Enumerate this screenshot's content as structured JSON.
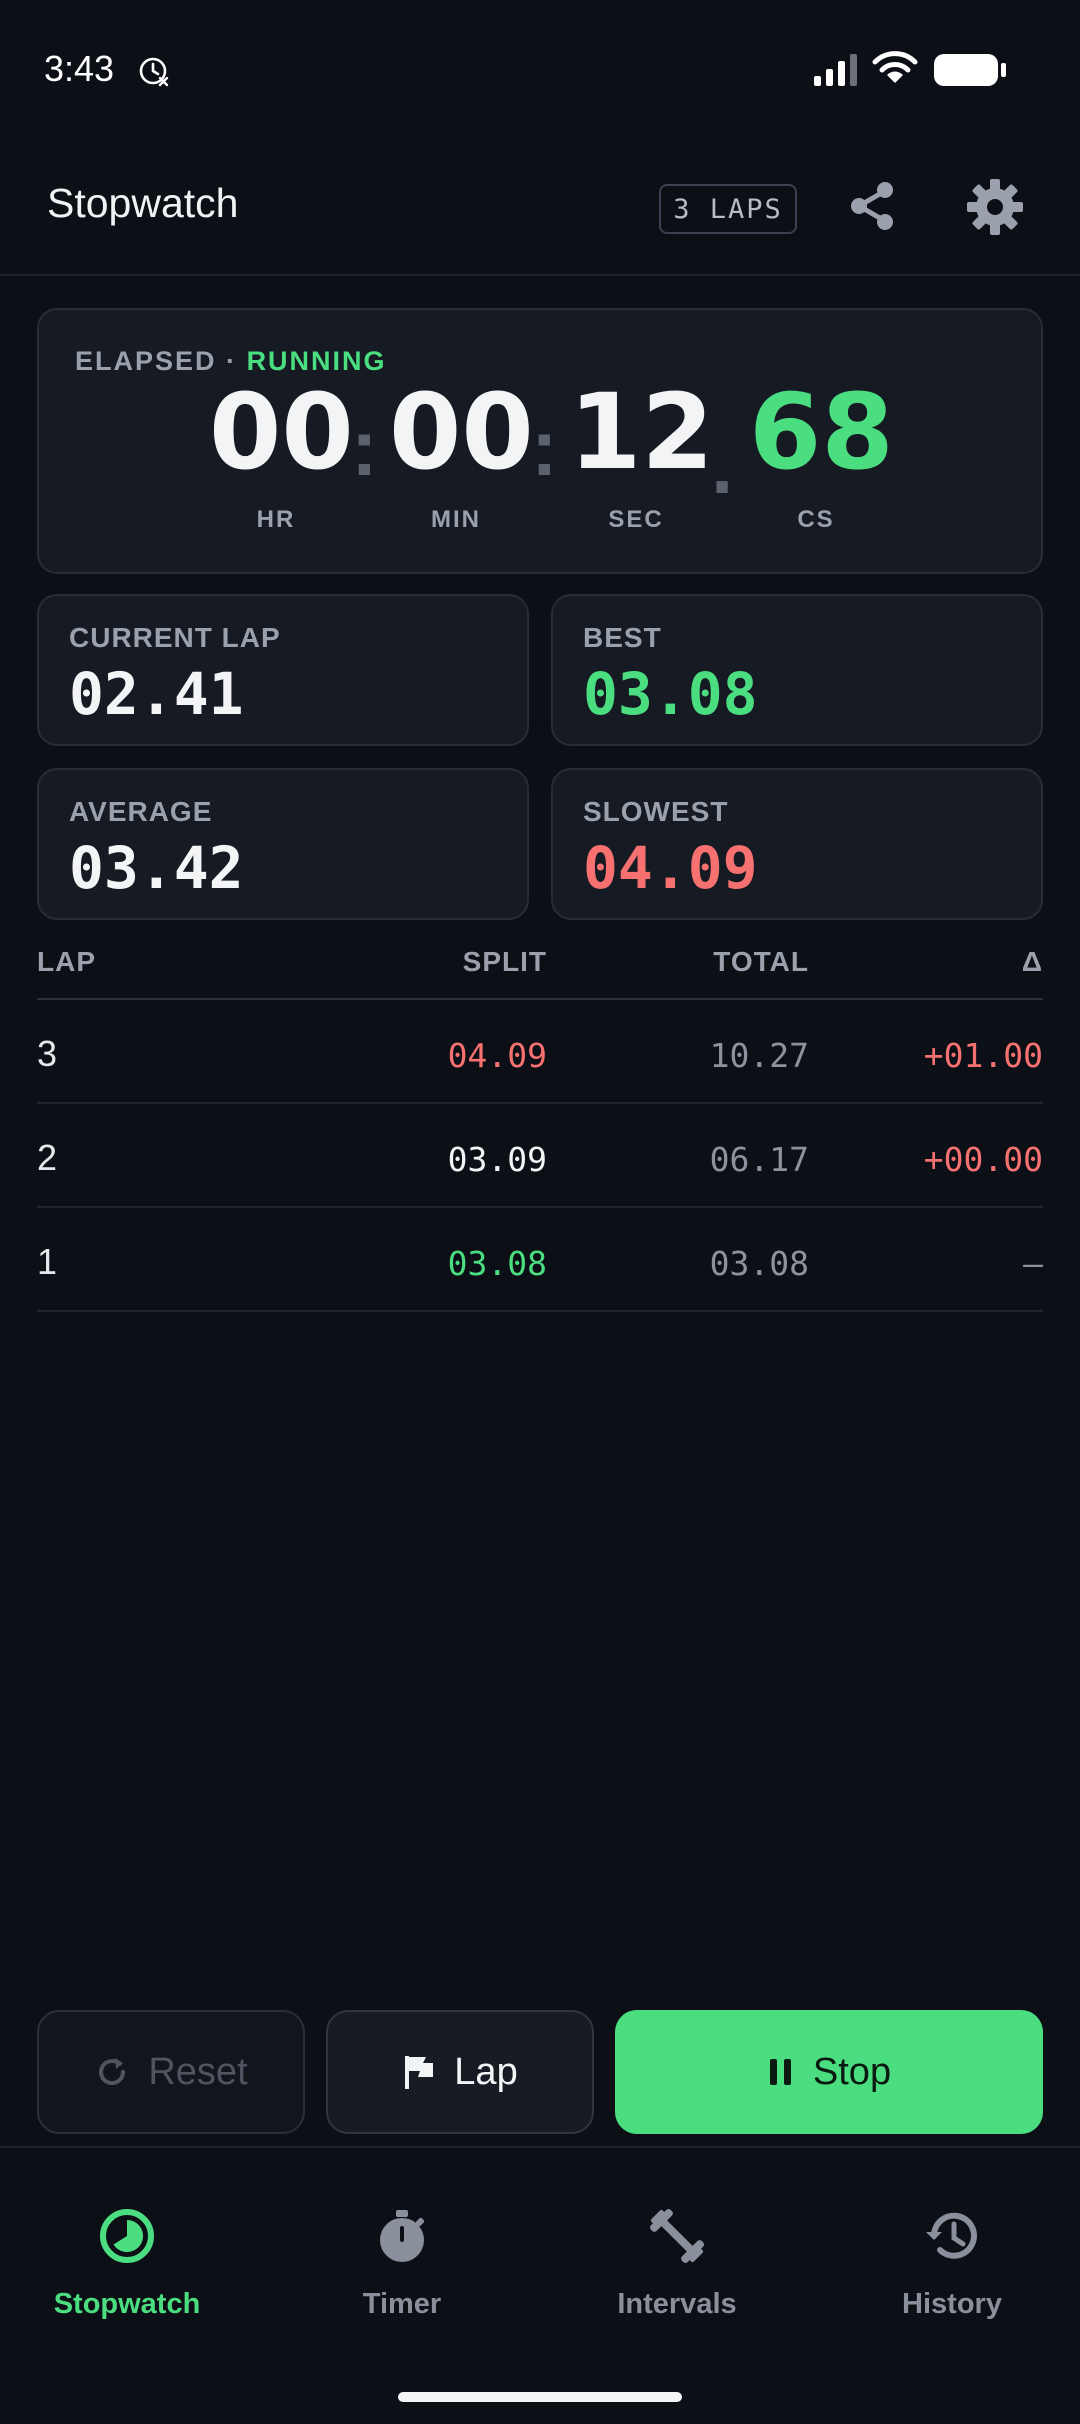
{
  "status_bar": {
    "time": "3:43"
  },
  "header": {
    "title": "Stopwatch",
    "laps_badge": "3 LAPS",
    "share_icon": "share-icon",
    "settings_icon": "gear-icon"
  },
  "elapsed": {
    "label": "ELAPSED",
    "separator": "·",
    "state": "RUNNING",
    "hours": "00",
    "minutes": "00",
    "seconds": "12",
    "centis": "68",
    "sep_colon": ":",
    "sep_dot": ".",
    "units": {
      "hr": "HR",
      "min": "MIN",
      "sec": "SEC",
      "cs": "CS"
    }
  },
  "stats": {
    "current_lap": {
      "label": "CURRENT LAP",
      "value": "02.41"
    },
    "best": {
      "label": "BEST",
      "value": "03.08"
    },
    "average": {
      "label": "AVERAGE",
      "value": "03.42"
    },
    "slowest": {
      "label": "SLOWEST",
      "value": "04.09"
    }
  },
  "lap_table": {
    "headers": {
      "lap": "LAP",
      "split": "SPLIT",
      "total": "TOTAL",
      "delta": "Δ"
    },
    "rows": [
      {
        "lap": "3",
        "split": "04.09",
        "total": "10.27",
        "delta": "+01.00"
      },
      {
        "lap": "2",
        "split": "03.09",
        "total": "06.17",
        "delta": "+00.00"
      },
      {
        "lap": "1",
        "split": "03.08",
        "total": "03.08",
        "delta": "–"
      }
    ]
  },
  "controls": {
    "reset_label": "Reset",
    "lap_label": "Lap",
    "stop_label": "Stop"
  },
  "nav": {
    "items": [
      {
        "label": "Stopwatch",
        "icon": "stopwatch-icon",
        "active": true
      },
      {
        "label": "Timer",
        "icon": "timer-icon",
        "active": false
      },
      {
        "label": "Intervals",
        "icon": "dumbbell-icon",
        "active": false
      },
      {
        "label": "History",
        "icon": "history-icon",
        "active": false
      }
    ]
  },
  "colors": {
    "accent": "#4ade80",
    "danger": "#f87171",
    "background": "#0c0f15",
    "card": "#161a22"
  }
}
